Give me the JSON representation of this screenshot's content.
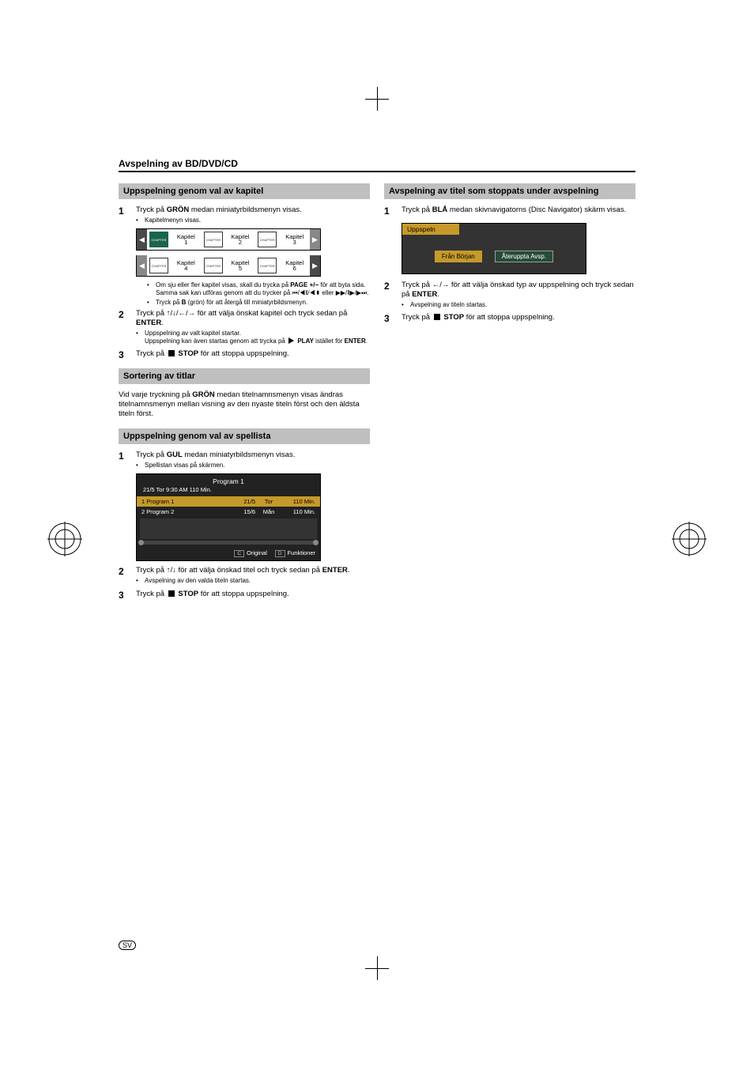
{
  "section_title": "Avspelning av BD/DVD/CD",
  "lang_badge": "SV",
  "left": {
    "h1": "Uppspelning genom val av kapitel",
    "s1": {
      "num": "1",
      "text_a": "Tryck på ",
      "bold1": "GRÖN",
      "text_b": " medan miniatyrbildsmenyn visas.",
      "bullet": "Kapitelmenyn visas."
    },
    "chapters": [
      {
        "label": "Kapitel",
        "n": "1"
      },
      {
        "label": "Kapitel",
        "n": "2"
      },
      {
        "label": "Kapitel",
        "n": "3"
      },
      {
        "label": "Kapitel",
        "n": "4"
      },
      {
        "label": "Kapitel",
        "n": "5"
      },
      {
        "label": "Kapitel",
        "n": "6"
      }
    ],
    "chapter_thumb_text": "CHAPTER",
    "s1_b1a": "Om sju eller fler kapitel visas, skall du trycka på ",
    "s1_b1_bold": "PAGE +/−",
    "s1_b1b": " för att byta sida. Samma sak kan utföras genom att du trycker på ",
    "s1_b1_glyphs1": "⏮/◀‖/◀▮",
    "s1_b1c": " eller ",
    "s1_b1_glyphs2": "▶▶/‖▶/▶⏭",
    "s1_b1d": ".",
    "s1_b2a": "Tryck på ",
    "s1_b2_bold": "B",
    "s1_b2b": " (grön) för att återgå till miniatyrbildsmenyn.",
    "s2": {
      "num": "2",
      "text_a": "Tryck på ",
      "arrows": "↑/↓/←/→",
      "text_b": " för att välja önskat kapitel och tryck sedan på ",
      "bold": "ENTER",
      "text_c": "."
    },
    "s2_b1": "Uppspelning av valt kapitel startar.",
    "s2_b2a": "Uppspelning kan även startas genom att trycka på ",
    "s2_b2_bold": "PLAY",
    "s2_b2b": " istället för ",
    "s2_b2_bold2": "ENTER",
    "s2_b2c": ".",
    "s3": {
      "num": "3",
      "text_a": "Tryck på ",
      "bold": "STOP",
      "text_b": " för att stoppa uppspelning."
    },
    "h2": "Sortering av titlar",
    "para_a": "Vid varje tryckning på ",
    "para_bold": "GRÖN",
    "para_b": " medan titelnamnsmenyn visas ändras titelnamnsmenyn mellan visning av den nyaste titeln först och den äldsta titeln först.",
    "h3": "Uppspelning genom val av spellista",
    "pl_s1": {
      "num": "1",
      "text_a": "Tryck på ",
      "bold": "GUL",
      "text_b": " medan miniatyrbildsmenyn visas.",
      "bullet": "Spellistan visas på skärmen."
    },
    "playlist": {
      "header": "Program 1",
      "sub": "21/5  Tor  9:30 AM  110 Min.",
      "rows": [
        {
          "name": "1 Program 1",
          "c1": "21/5",
          "c2": "Tor",
          "c3": "110 Min."
        },
        {
          "name": "2 Program 2",
          "c1": "15/6",
          "c2": "Mån",
          "c3": "110 Min."
        }
      ],
      "tagC": "C",
      "footC": "Original",
      "tagD": "D",
      "footD": "Funktioner"
    },
    "pl_s2": {
      "num": "2",
      "text_a": "Tryck på ",
      "arrows": "↑/↓",
      "text_b": " för att välja önskad titel och tryck sedan på ",
      "bold": "ENTER",
      "text_c": ".",
      "bullet": "Avspelning av den valda titeln startas."
    },
    "pl_s3": {
      "num": "3",
      "text_a": "Tryck på ",
      "bold": "STOP",
      "text_b": " för att stoppa uppspelning."
    }
  },
  "right": {
    "h1": "Avspelning av titel som stoppats under avspelning",
    "s1": {
      "num": "1",
      "text_a": "Tryck på ",
      "bold": "BLÅ",
      "text_b": " medan skivnavigatorns (Disc Navigator) skärm visas."
    },
    "resume": {
      "title": "Uppspeln",
      "btn1": "Från Början",
      "btn2": "Återuppta Avsp."
    },
    "s2": {
      "num": "2",
      "text_a": "Tryck på ",
      "arrows": "←/→",
      "text_b": " för att välja önskad typ av uppspelning och tryck sedan på ",
      "bold": "ENTER",
      "text_c": ".",
      "bullet": "Avspelning av titeln startas."
    },
    "s3": {
      "num": "3",
      "text_a": "Tryck på ",
      "bold": "STOP",
      "text_b": " för att stoppa uppspelning."
    }
  }
}
